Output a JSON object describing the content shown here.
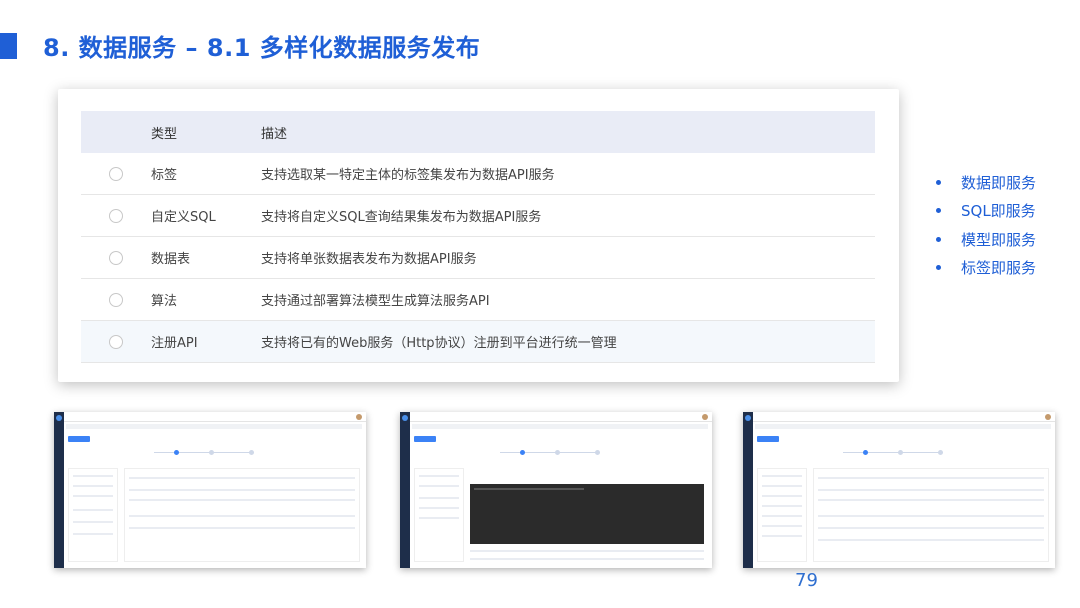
{
  "header": {
    "title": "8. 数据服务 – 8.1 多样化数据服务发布"
  },
  "table": {
    "columns": [
      "类型",
      "描述"
    ],
    "rows": [
      {
        "type": "标签",
        "desc": "支持选取某一特定主体的标签集发布为数据API服务"
      },
      {
        "type": "自定义SQL",
        "desc": "支持将自定义SQL查询结果集发布为数据API服务"
      },
      {
        "type": "数据表",
        "desc": "支持将单张数据表发布为数据API服务"
      },
      {
        "type": "算法",
        "desc": "支持通过部署算法模型生成算法服务API"
      },
      {
        "type": "注册API",
        "desc": "支持将已有的Web服务（Http协议）注册到平台进行统一管理"
      }
    ]
  },
  "bullets": [
    "数据即服务",
    "SQL即服务",
    "模型即服务",
    "标签即服务"
  ],
  "footer": {
    "page_number": "79"
  },
  "colors": {
    "accent": "#1f5fd6",
    "table_header": "#e9ecf6"
  }
}
